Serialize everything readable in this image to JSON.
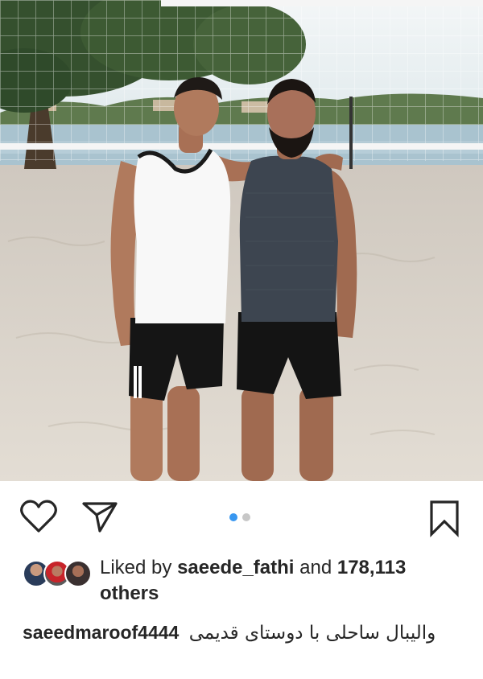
{
  "post": {
    "image": {
      "description": "beach volleyball photo",
      "colors": {
        "sky": "#e8f0f2",
        "sand": "#d9d2c8",
        "water": "#a9c3cf",
        "tree": "#2f4a2a",
        "net": "#f2f2f2"
      }
    },
    "carousel": {
      "count": 2,
      "active": 1,
      "active_color": "#3897f0",
      "inactive_color": "#c7c7c7"
    },
    "actions": {
      "like_icon": "heart-outline",
      "share_icon": "paper-plane",
      "save_icon": "bookmark-outline"
    },
    "likes": {
      "prefix": "Liked by",
      "user": "saeede_fathi",
      "middle": "and",
      "count": "178,113",
      "suffix": "others"
    },
    "caption": {
      "username": "saeedmaroof4444",
      "text": "والیبال ساحلی با دوستای قدیمی"
    }
  }
}
